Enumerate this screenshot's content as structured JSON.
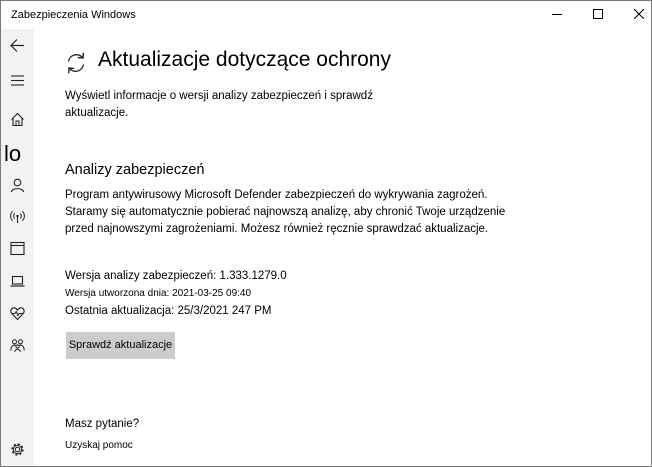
{
  "window": {
    "title": "Zabezpieczenia Windows"
  },
  "sidebar": {
    "items": [
      {
        "name": "back",
        "icon": "back-arrow-icon"
      },
      {
        "name": "menu",
        "icon": "hamburger-icon"
      },
      {
        "name": "home",
        "icon": "home-icon"
      },
      {
        "name": "virus-protection",
        "glyph": "lo"
      },
      {
        "name": "account-protection",
        "icon": "person-icon"
      },
      {
        "name": "firewall-network",
        "icon": "wireless-icon"
      },
      {
        "name": "app-browser-control",
        "icon": "browser-window-icon"
      },
      {
        "name": "device-security",
        "icon": "laptop-icon"
      },
      {
        "name": "device-performance",
        "icon": "heart-health-icon"
      },
      {
        "name": "family-options",
        "icon": "family-icon"
      },
      {
        "name": "settings",
        "icon": "gear-icon"
      }
    ]
  },
  "page": {
    "title": "Aktualizacje dotyczące ochrony",
    "intro": "Wyświetl informacje o wersji analizy zabezpieczeń i sprawdź aktualizacje."
  },
  "security_intelligence": {
    "heading": "Analizy zabezpieczeń",
    "description": "Program antywirusowy Microsoft Defender zabezpieczeń do wykrywania zagrożeń. Staramy się automatycznie pobierać najnowszą analizę, aby chronić Twoje urządzenie przed najnowszymi zagrożeniami. Możesz również ręcznie sprawdzać aktualizacje.",
    "version": "Wersja analizy zabezpieczeń: 1.333.1279.0",
    "created": "Wersja utworzona dnia: 2021-03-25 09:40",
    "last_update": "Ostatnia aktualizacja: 25/3/2021 247 PM",
    "check_button": "Sprawdź aktualizacje"
  },
  "help": {
    "question": "Masz pytanie?",
    "link": "Uzyskaj pomoc"
  },
  "colors": {
    "sidebar_bg": "#f2f2f2",
    "button_bg": "#cccccc",
    "window_border": "#7a7a7a"
  }
}
